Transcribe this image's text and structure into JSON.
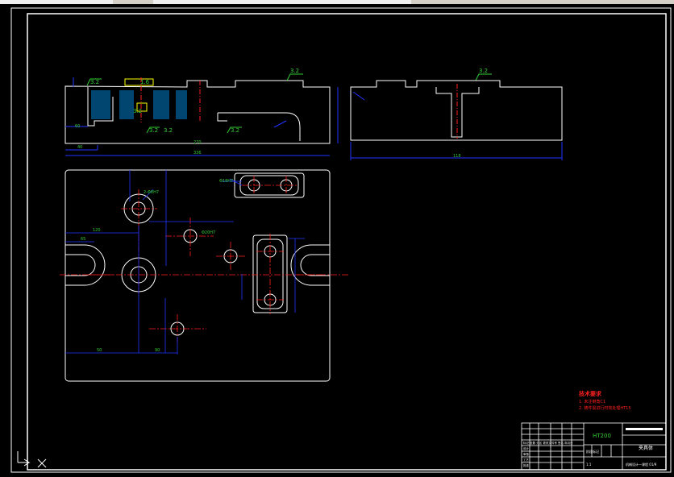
{
  "colors": {
    "background": "#000000",
    "outline": "#ffffff",
    "dimension": "#2233ff",
    "centerline": "#ff2020",
    "hatch": "#00b0ff",
    "annotation": "#33cc33",
    "note": "#ff2020"
  },
  "dims": {
    "front_w1": "40",
    "front_w2": "60",
    "front_total": "336",
    "front_mid": "270",
    "side_total": "118",
    "plan_h1": "120",
    "plan_h2": "65",
    "plan_b1": "50",
    "plan_b2": "90",
    "slot_dim": "Φ18H7",
    "hole_dim1": "Φ20H7",
    "hole_dim2": "2-Φ8H7"
  },
  "roughness": {
    "r1": "3.2",
    "r2": "1.6",
    "r3": "3.2",
    "r4": "3.2",
    "r5": "3.2",
    "r6": "3.2",
    "r7": "3.2",
    "r8": "3.2"
  },
  "notes": {
    "title": "技术要求",
    "line1": "1. 未注倒角C1",
    "line2": "2. 铸件需进行时效处理HT15"
  },
  "title_block": {
    "material": "HT200",
    "name": "夹具体",
    "drawing_no": "",
    "scale": "1:1",
    "company": "机械设计—课程 01/9",
    "rows": [
      "标记 处数 分区 更改文件号 签名 年月日",
      "设计",
      "审核",
      "工艺",
      "批准"
    ],
    "col_labels": [
      "阶段标记",
      "重量",
      "比例"
    ]
  }
}
